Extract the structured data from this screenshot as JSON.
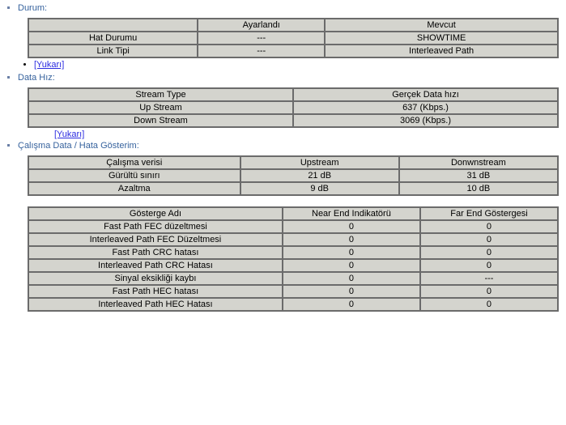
{
  "sections": {
    "durum": {
      "label": "Durum:",
      "headers": [
        "Ayarlandı",
        "Mevcut"
      ],
      "rows": [
        {
          "name": "Hat Durumu",
          "set": "---",
          "current": "SHOWTIME"
        },
        {
          "name": "Link Tipi",
          "set": "---",
          "current": "Interleaved Path"
        }
      ],
      "up": "[Yukarı]"
    },
    "datahiz": {
      "label": "Data Hız:",
      "headers": [
        "Stream Type",
        "Gerçek Data hızı"
      ],
      "rows": [
        {
          "name": "Up Stream",
          "value": "637 (Kbps.)"
        },
        {
          "name": "Down Stream",
          "value": "3069 (Kbps.)"
        }
      ],
      "up": "[Yukarı]"
    },
    "calisma": {
      "label": "Çalışma Data / Hata Gösterim:",
      "headers": [
        "Çalışma verisi",
        "Upstream",
        "Donwnstream"
      ],
      "rows": [
        {
          "name": "Gürültü sınırı",
          "up": "21 dB",
          "down": "31 dB"
        },
        {
          "name": "Azaltma",
          "up": "9 dB",
          "down": "10 dB"
        }
      ]
    },
    "gosterge": {
      "headers": [
        "Gösterge Adı",
        "Near End Indikatörü",
        "Far End Göstergesi"
      ],
      "rows": [
        {
          "name": "Fast Path FEC düzeltmesi",
          "near": "0",
          "far": "0"
        },
        {
          "name": "Interleaved Path FEC Düzeltmesi",
          "near": "0",
          "far": "0"
        },
        {
          "name": "Fast Path CRC hatası",
          "near": "0",
          "far": "0"
        },
        {
          "name": "Interleaved Path CRC Hatası",
          "near": "0",
          "far": "0"
        },
        {
          "name": "Sinyal eksikliği kaybı",
          "near": "0",
          "far": "---"
        },
        {
          "name": "Fast Path HEC hatası",
          "near": "0",
          "far": "0"
        },
        {
          "name": "Interleaved Path HEC Hatası",
          "near": "0",
          "far": "0"
        }
      ]
    }
  }
}
